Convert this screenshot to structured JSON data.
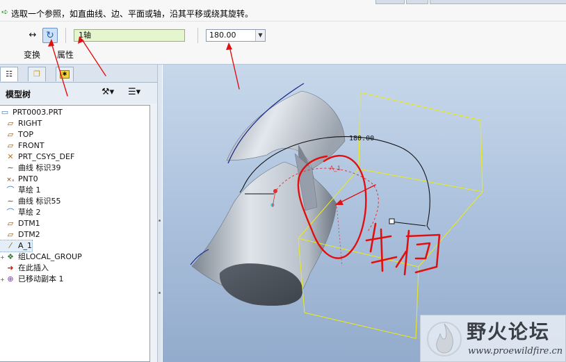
{
  "message": {
    "text": "选取一个参照，如直曲线、边、平面或轴，沿其平移或绕其旋转。",
    "icon": "arrow-right-icon"
  },
  "dashboard": {
    "move_icon": "↔",
    "rotate_icon": "↻",
    "reference_value": "1轴",
    "angle_value": "180.00",
    "tabs": [
      "变换",
      "属性"
    ]
  },
  "panel": {
    "title": "模型树",
    "tabs": [
      "model-tree-tab",
      "layer-tab",
      "favorites-tab"
    ],
    "tree": [
      {
        "label": "PRT0003.PRT",
        "icon": "part-icon",
        "glyph": "▭",
        "cls": "part",
        "level": 0,
        "expander": ""
      },
      {
        "label": "RIGHT",
        "icon": "datum-plane-icon",
        "glyph": "▱",
        "cls": "datum",
        "level": 1,
        "expander": ""
      },
      {
        "label": "TOP",
        "icon": "datum-plane-icon",
        "glyph": "▱",
        "cls": "datum",
        "level": 1,
        "expander": ""
      },
      {
        "label": "FRONT",
        "icon": "datum-plane-icon",
        "glyph": "▱",
        "cls": "datum",
        "level": 1,
        "expander": ""
      },
      {
        "label": "PRT_CSYS_DEF",
        "icon": "csys-icon",
        "glyph": "✕",
        "cls": "csys",
        "level": 1,
        "expander": ""
      },
      {
        "label": "曲线 标识39",
        "icon": "curve-icon",
        "glyph": "∼",
        "cls": "curve",
        "level": 1,
        "expander": ""
      },
      {
        "label": "PNT0",
        "icon": "datum-point-icon",
        "glyph": "×ₓ",
        "cls": "point",
        "level": 1,
        "expander": ""
      },
      {
        "label": "草绘 1",
        "icon": "sketch-icon",
        "glyph": "⌒",
        "cls": "sketch",
        "level": 1,
        "expander": ""
      },
      {
        "label": "曲线 标识55",
        "icon": "curve-icon",
        "glyph": "∼",
        "cls": "curve",
        "level": 1,
        "expander": ""
      },
      {
        "label": "草绘 2",
        "icon": "sketch-icon",
        "glyph": "⌒",
        "cls": "sketch",
        "level": 1,
        "expander": ""
      },
      {
        "label": "DTM1",
        "icon": "datum-plane-icon",
        "glyph": "▱",
        "cls": "datum",
        "level": 1,
        "expander": ""
      },
      {
        "label": "DTM2",
        "icon": "datum-plane-icon",
        "glyph": "▱",
        "cls": "datum",
        "level": 1,
        "expander": ""
      },
      {
        "label": "A_1",
        "icon": "datum-axis-icon",
        "glyph": "⁄",
        "cls": "axis",
        "level": 1,
        "expander": "",
        "selected": true
      },
      {
        "label": "组LOCAL_GROUP",
        "icon": "group-icon",
        "glyph": "❖",
        "cls": "group",
        "level": 1,
        "expander": "+"
      },
      {
        "label": "在此插入",
        "icon": "insert-here-icon",
        "glyph": "➜",
        "cls": "insert",
        "level": 1,
        "expander": ""
      },
      {
        "label": "已移动副本 1",
        "icon": "moved-copy-icon",
        "glyph": "⊕",
        "cls": "copy",
        "level": 1,
        "expander": "+"
      }
    ]
  },
  "viewport": {
    "angle_label": "180.00",
    "handwritten_note": "轴"
  },
  "watermark": {
    "title": "野火论坛",
    "url": "www.proewildfire.cn"
  },
  "colors": {
    "annotation_red": "#e01010",
    "bounding_box": "#e8e820",
    "surface": "#c4ccd6",
    "surface_dark": "#4a5058"
  }
}
